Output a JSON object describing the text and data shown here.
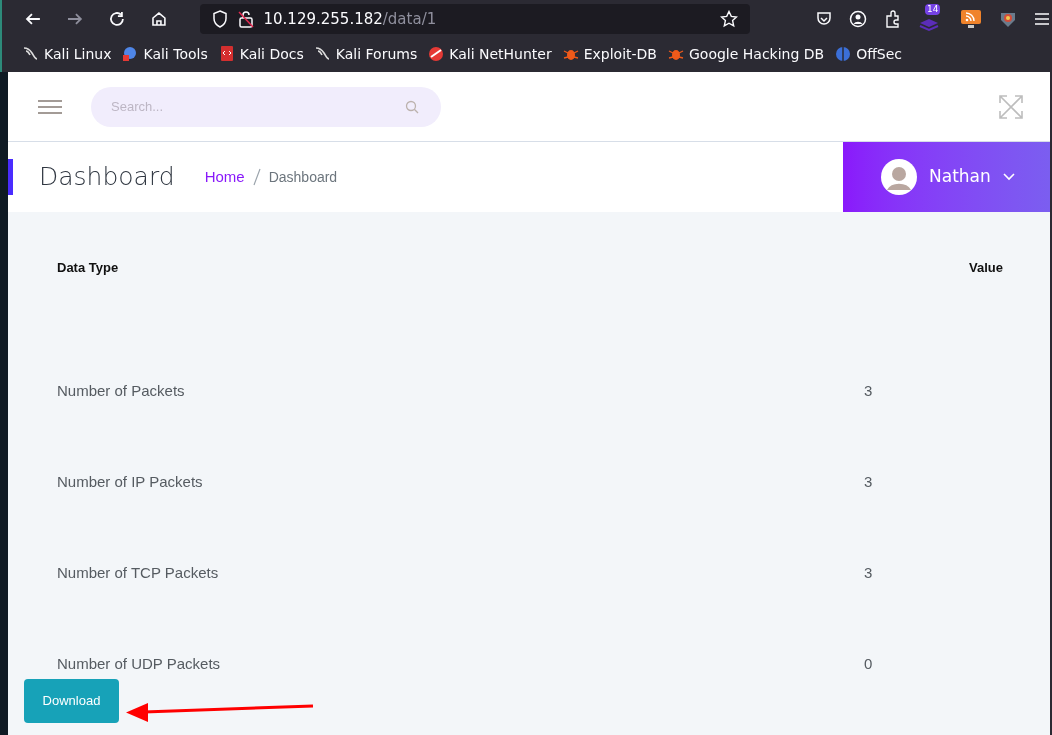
{
  "browser": {
    "url_host": "10.129.255.182",
    "url_path": "/data/1",
    "extension_badge": "14",
    "bookmarks": [
      {
        "label": "Kali Linux",
        "kind": "dragon"
      },
      {
        "label": "Kali Tools",
        "kind": "tools"
      },
      {
        "label": "Kali Docs",
        "kind": "docs"
      },
      {
        "label": "Kali Forums",
        "kind": "dragon"
      },
      {
        "label": "Kali NetHunter",
        "kind": "nethunter"
      },
      {
        "label": "Exploit-DB",
        "kind": "bug"
      },
      {
        "label": "Google Hacking DB",
        "kind": "bug"
      },
      {
        "label": "OffSec",
        "kind": "offsec"
      }
    ]
  },
  "header": {
    "search": {
      "placeholder": "Search..."
    }
  },
  "title_bar": {
    "title": "Dashboard",
    "breadcrumb": [
      {
        "label": "Home",
        "kind": "link"
      },
      {
        "label": "Dashboard",
        "kind": "current"
      }
    ],
    "user": {
      "name": "Nathan"
    }
  },
  "table": {
    "columns": [
      "Data Type",
      "Value"
    ],
    "rows": [
      {
        "data_type": "Number of Packets",
        "value": "3"
      },
      {
        "data_type": "Number of IP Packets",
        "value": "3"
      },
      {
        "data_type": "Number of TCP Packets",
        "value": "3"
      },
      {
        "data_type": "Number of UDP Packets",
        "value": "0"
      }
    ]
  },
  "download_button": "Download"
}
